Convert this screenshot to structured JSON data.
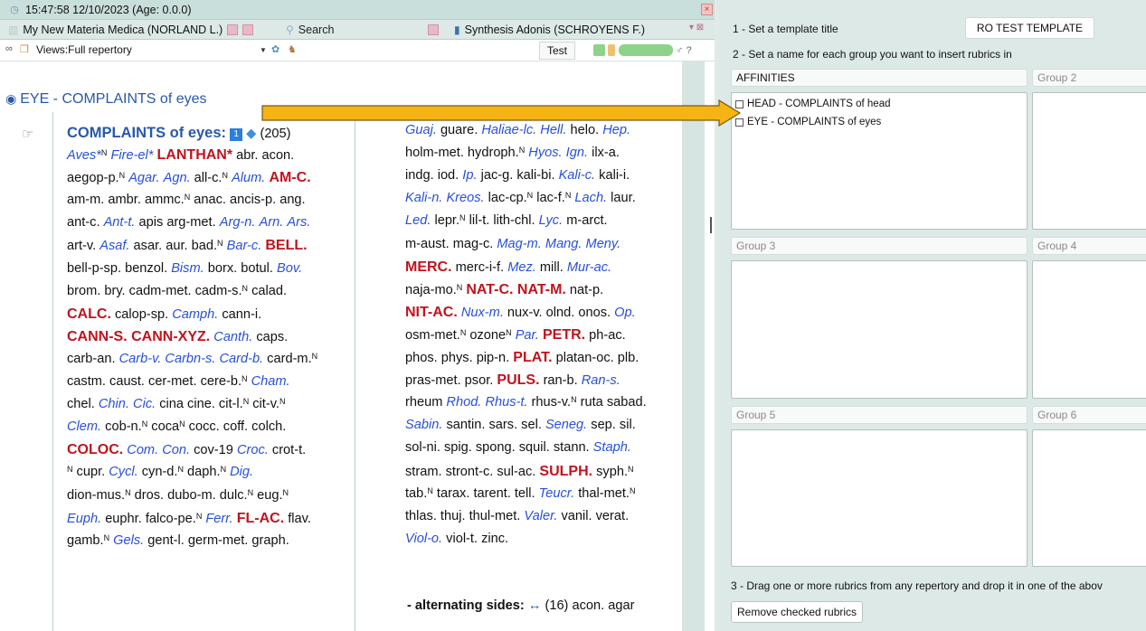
{
  "window": {
    "title": "15:47:58 12/10/2023 (Age: 0.0.0)",
    "tab1": "My New Materia Medica (NORLAND L.)",
    "tab_search": "Search",
    "tab2": "Synthesis Adonis (SCHROYENS F.)",
    "views_label": "Views:",
    "views_value": "Full repertory",
    "test_label": "Test"
  },
  "rubric": {
    "header": "EYE - COMPLAINTS of eyes",
    "name": "COMPLAINTS of eyes:",
    "count": "(205)",
    "alternating_label": "- alternating sides:",
    "alternating_symbol": "↔",
    "alternating_rest": "(16) acon. agar"
  },
  "remedy_lines_col1": [
    [
      [
        "i",
        "Aves*"
      ],
      [
        "s",
        "N"
      ],
      [
        "p",
        " "
      ],
      [
        "i",
        "Fire-el*"
      ],
      [
        "p",
        " "
      ],
      [
        "b",
        "LANTHAN*"
      ],
      [
        "p",
        " abr. acon."
      ]
    ],
    [
      [
        "p",
        "aegop-p."
      ],
      [
        "s",
        "N"
      ],
      [
        "p",
        " "
      ],
      [
        "i",
        "Agar."
      ],
      [
        "p",
        " "
      ],
      [
        "i",
        "Agn."
      ],
      [
        "p",
        " all-c."
      ],
      [
        "s",
        "N"
      ],
      [
        "p",
        " "
      ],
      [
        "i",
        "Alum."
      ],
      [
        "p",
        " "
      ],
      [
        "b",
        "AM-C."
      ]
    ],
    [
      [
        "p",
        "am-m. ambr. ammc."
      ],
      [
        "s",
        "N"
      ],
      [
        "p",
        " anac. ancis-p. ang."
      ]
    ],
    [
      [
        "p",
        "ant-c. "
      ],
      [
        "i",
        "Ant-t."
      ],
      [
        "p",
        " apis arg-met. "
      ],
      [
        "i",
        "Arg-n."
      ],
      [
        "p",
        " "
      ],
      [
        "i",
        "Arn."
      ],
      [
        "p",
        " "
      ],
      [
        "i",
        "Ars."
      ]
    ],
    [
      [
        "p",
        "art-v. "
      ],
      [
        "i",
        "Asaf."
      ],
      [
        "p",
        " asar. aur. bad."
      ],
      [
        "s",
        "N"
      ],
      [
        "p",
        " "
      ],
      [
        "i",
        "Bar-c."
      ],
      [
        "p",
        " "
      ],
      [
        "b",
        "BELL."
      ]
    ],
    [
      [
        "p",
        "bell-p-sp. benzol. "
      ],
      [
        "i",
        "Bism."
      ],
      [
        "p",
        " borx. botul. "
      ],
      [
        "i",
        "Bov."
      ]
    ],
    [
      [
        "p",
        "brom. bry. cadm-met. cadm-s."
      ],
      [
        "s",
        "N"
      ],
      [
        "p",
        " calad."
      ]
    ],
    [
      [
        "b",
        "CALC."
      ],
      [
        "p",
        " calop-sp. "
      ],
      [
        "i",
        "Camph."
      ],
      [
        "p",
        " cann-i."
      ]
    ],
    [
      [
        "b",
        "CANN-S. CANN-XYZ."
      ],
      [
        "p",
        " "
      ],
      [
        "i",
        "Canth."
      ],
      [
        "p",
        " caps."
      ]
    ],
    [
      [
        "p",
        "carb-an. "
      ],
      [
        "i",
        "Carb-v."
      ],
      [
        "p",
        " "
      ],
      [
        "i",
        "Carbn-s."
      ],
      [
        "p",
        " "
      ],
      [
        "i",
        "Card-b."
      ],
      [
        "p",
        " card-m."
      ],
      [
        "s",
        "N"
      ]
    ],
    [
      [
        "p",
        "castm. caust. cer-met. cere-b."
      ],
      [
        "s",
        "N"
      ],
      [
        "p",
        " "
      ],
      [
        "i",
        "Cham."
      ]
    ],
    [
      [
        "p",
        "chel. "
      ],
      [
        "i",
        "Chin."
      ],
      [
        "p",
        " "
      ],
      [
        "i",
        "Cic."
      ],
      [
        "p",
        " cina cine. cit-l."
      ],
      [
        "s",
        "N"
      ],
      [
        "p",
        " cit-v."
      ],
      [
        "s",
        "N"
      ]
    ],
    [
      [
        "i",
        "Clem."
      ],
      [
        "p",
        " cob-n."
      ],
      [
        "s",
        "N"
      ],
      [
        "p",
        " coca"
      ],
      [
        "s",
        "N"
      ],
      [
        "p",
        " cocc. coff. colch."
      ]
    ],
    [
      [
        "b",
        "COLOC."
      ],
      [
        "p",
        " "
      ],
      [
        "i",
        "Com."
      ],
      [
        "p",
        " "
      ],
      [
        "i",
        "Con."
      ],
      [
        "p",
        " cov-19 "
      ],
      [
        "i",
        "Croc."
      ],
      [
        "p",
        " crot-t."
      ]
    ],
    [
      [
        "s",
        "N"
      ],
      [
        "p",
        " cupr. "
      ],
      [
        "i",
        "Cycl."
      ],
      [
        "p",
        " cyn-d."
      ],
      [
        "s",
        "N"
      ],
      [
        "p",
        " daph."
      ],
      [
        "s",
        "N"
      ],
      [
        "p",
        " "
      ],
      [
        "i",
        "Dig."
      ]
    ],
    [
      [
        "p",
        "dion-mus."
      ],
      [
        "s",
        "N"
      ],
      [
        "p",
        " dros. dubo-m. dulc."
      ],
      [
        "s",
        "N"
      ],
      [
        "p",
        " eug."
      ],
      [
        "s",
        "N"
      ]
    ],
    [
      [
        "i",
        "Euph."
      ],
      [
        "p",
        " euphr. falco-pe."
      ],
      [
        "s",
        "N"
      ],
      [
        "p",
        " "
      ],
      [
        "i",
        "Ferr."
      ],
      [
        "p",
        " "
      ],
      [
        "b",
        "FL-AC."
      ],
      [
        "p",
        " flav."
      ]
    ],
    [
      [
        "p",
        "gamb."
      ],
      [
        "s",
        "N"
      ],
      [
        "p",
        " "
      ],
      [
        "i",
        "Gels."
      ],
      [
        "p",
        " gent-l. germ-met. graph."
      ]
    ]
  ],
  "remedy_lines_col2": [
    [
      [
        "i",
        "Guaj."
      ],
      [
        "p",
        " guare. "
      ],
      [
        "i",
        "Haliae-lc."
      ],
      [
        "p",
        " "
      ],
      [
        "i",
        "Hell."
      ],
      [
        "p",
        " helo. "
      ],
      [
        "i",
        "Hep."
      ]
    ],
    [
      [
        "p",
        "holm-met. hydroph."
      ],
      [
        "s",
        "N"
      ],
      [
        "p",
        " "
      ],
      [
        "i",
        "Hyos."
      ],
      [
        "p",
        " "
      ],
      [
        "i",
        "Ign."
      ],
      [
        "p",
        " ilx-a."
      ]
    ],
    [
      [
        "p",
        "indg. iod. "
      ],
      [
        "i",
        "Ip."
      ],
      [
        "p",
        " jac-g. kali-bi. "
      ],
      [
        "i",
        "Kali-c."
      ],
      [
        "p",
        " kali-i."
      ]
    ],
    [
      [
        "i",
        "Kali-n."
      ],
      [
        "p",
        " "
      ],
      [
        "i",
        "Kreos."
      ],
      [
        "p",
        " lac-cp."
      ],
      [
        "s",
        "N"
      ],
      [
        "p",
        " lac-f."
      ],
      [
        "s",
        "N"
      ],
      [
        "p",
        " "
      ],
      [
        "i",
        "Lach."
      ],
      [
        "p",
        " laur."
      ]
    ],
    [
      [
        "i",
        "Led."
      ],
      [
        "p",
        " lepr."
      ],
      [
        "s",
        "N"
      ],
      [
        "p",
        " lil-t. lith-chl. "
      ],
      [
        "i",
        "Lyc."
      ],
      [
        "p",
        " m-arct."
      ]
    ],
    [
      [
        "p",
        "m-aust. mag-c. "
      ],
      [
        "i",
        "Mag-m."
      ],
      [
        "p",
        " "
      ],
      [
        "i",
        "Mang."
      ],
      [
        "p",
        " "
      ],
      [
        "i",
        "Meny."
      ]
    ],
    [
      [
        "b",
        "MERC."
      ],
      [
        "p",
        " merc-i-f. "
      ],
      [
        "i",
        "Mez."
      ],
      [
        "p",
        " mill. "
      ],
      [
        "i",
        "Mur-ac."
      ]
    ],
    [
      [
        "p",
        "naja-mo."
      ],
      [
        "s",
        "N"
      ],
      [
        "p",
        " "
      ],
      [
        "b",
        "NAT-C. NAT-M."
      ],
      [
        "p",
        " nat-p."
      ]
    ],
    [
      [
        "b",
        "NIT-AC."
      ],
      [
        "p",
        " "
      ],
      [
        "i",
        "Nux-m."
      ],
      [
        "p",
        " nux-v. olnd. onos. "
      ],
      [
        "i",
        "Op."
      ]
    ],
    [
      [
        "p",
        "osm-met."
      ],
      [
        "s",
        "N"
      ],
      [
        "p",
        " ozone"
      ],
      [
        "s",
        "N"
      ],
      [
        "p",
        " "
      ],
      [
        "i",
        "Par."
      ],
      [
        "p",
        " "
      ],
      [
        "b",
        "PETR."
      ],
      [
        "p",
        " ph-ac."
      ]
    ],
    [
      [
        "p",
        "phos. phys. pip-n. "
      ],
      [
        "b",
        "PLAT."
      ],
      [
        "p",
        " platan-oc. plb."
      ]
    ],
    [
      [
        "p",
        "pras-met. psor. "
      ],
      [
        "b",
        "PULS."
      ],
      [
        "p",
        " ran-b. "
      ],
      [
        "i",
        "Ran-s."
      ]
    ],
    [
      [
        "p",
        "rheum "
      ],
      [
        "i",
        "Rhod."
      ],
      [
        "p",
        " "
      ],
      [
        "i",
        "Rhus-t."
      ],
      [
        "p",
        " rhus-v."
      ],
      [
        "s",
        "N"
      ],
      [
        "p",
        " ruta sabad."
      ]
    ],
    [
      [
        "i",
        "Sabin."
      ],
      [
        "p",
        " santin. sars. sel. "
      ],
      [
        "i",
        "Seneg."
      ],
      [
        "p",
        " sep. sil."
      ]
    ],
    [
      [
        "p",
        "sol-ni. spig. spong. squil. stann. "
      ],
      [
        "i",
        "Staph."
      ]
    ],
    [
      [
        "p",
        "stram. stront-c. sul-ac. "
      ],
      [
        "b",
        "SULPH."
      ],
      [
        "p",
        " syph."
      ],
      [
        "s",
        "N"
      ]
    ],
    [
      [
        "p",
        "tab."
      ],
      [
        "s",
        "N"
      ],
      [
        "p",
        " tarax. tarent. tell. "
      ],
      [
        "i",
        "Teucr."
      ],
      [
        "p",
        " thal-met."
      ],
      [
        "s",
        "N"
      ]
    ],
    [
      [
        "p",
        "thlas. thuj. thul-met. "
      ],
      [
        "i",
        "Valer."
      ],
      [
        "p",
        " vanil. verat."
      ]
    ],
    [
      [
        "i",
        "Viol-o."
      ],
      [
        "p",
        " viol-t. zinc."
      ]
    ]
  ],
  "template": {
    "step1": "1 - Set a template title",
    "title_value": "RO TEST TEMPLATE",
    "step2": "2 - Set a name for each group you want to insert rubrics in",
    "groups": [
      {
        "name": "AFFINITIES",
        "items": [
          "HEAD - COMPLAINTS of head",
          "EYE - COMPLAINTS of eyes"
        ]
      },
      {
        "name": "Group 2",
        "items": []
      },
      {
        "name": "Group 3",
        "items": []
      },
      {
        "name": "Group 4",
        "items": []
      },
      {
        "name": "Group 5",
        "items": []
      },
      {
        "name": "Group 6",
        "items": []
      }
    ],
    "step3": "3 - Drag one or more rubrics from any repertory and drop it in one of the abov",
    "remove_button": "Remove checked rubrics"
  },
  "colors": {
    "rubric_blue": "#2859a8",
    "remedy_bold_red": "#c0141e",
    "remedy_italic_blue": "#2750d8",
    "panel_bg": "#dde9e7",
    "arrow": "#f5b414"
  },
  "icons": [
    "clock-icon",
    "search-icon",
    "book-icon",
    "binoculars-icon",
    "eye-icon",
    "hand-icon",
    "diamond-icon",
    "checkbox-icon",
    "arrow-icon"
  ]
}
